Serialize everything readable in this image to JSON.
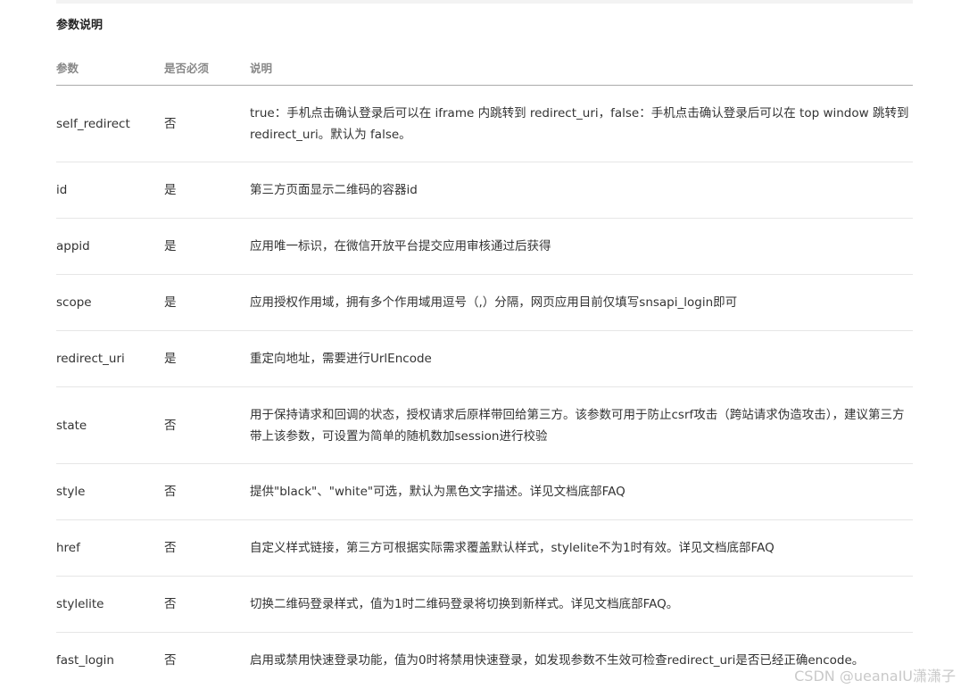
{
  "section": {
    "title": "参数说明"
  },
  "table": {
    "headers": [
      "参数",
      "是否必须",
      "说明"
    ],
    "rows": [
      {
        "param": "self_redirect",
        "required": "否",
        "desc": "true：手机点击确认登录后可以在 iframe 内跳转到 redirect_uri，false：手机点击确认登录后可以在 top window 跳转到 redirect_uri。默认为 false。"
      },
      {
        "param": "id",
        "required": "是",
        "desc": "第三方页面显示二维码的容器id"
      },
      {
        "param": "appid",
        "required": "是",
        "desc": "应用唯一标识，在微信开放平台提交应用审核通过后获得"
      },
      {
        "param": "scope",
        "required": "是",
        "desc": "应用授权作用域，拥有多个作用域用逗号（,）分隔，网页应用目前仅填写snsapi_login即可"
      },
      {
        "param": "redirect_uri",
        "required": "是",
        "desc": "重定向地址，需要进行UrlEncode"
      },
      {
        "param": "state",
        "required": "否",
        "desc": "用于保持请求和回调的状态，授权请求后原样带回给第三方。该参数可用于防止csrf攻击（跨站请求伪造攻击），建议第三方带上该参数，可设置为简单的随机数加session进行校验"
      },
      {
        "param": "style",
        "required": "否",
        "desc": "提供\"black\"、\"white\"可选，默认为黑色文字描述。详见文档底部FAQ"
      },
      {
        "param": "href",
        "required": "否",
        "desc": "自定义样式链接，第三方可根据实际需求覆盖默认样式，stylelite不为1时有效。详见文档底部FAQ"
      },
      {
        "param": "stylelite",
        "required": "否",
        "desc": "切换二维码登录样式，值为1时二维码登录将切换到新样式。详见文档底部FAQ。"
      },
      {
        "param": "fast_login",
        "required": "否",
        "desc": "启用或禁用快速登录功能，值为0时将禁用快速登录，如发现参数不生效可检查redirect_uri是否已经正确encode。"
      }
    ]
  },
  "watermark": {
    "text": "CSDN @ueanaIU潇潇子"
  }
}
